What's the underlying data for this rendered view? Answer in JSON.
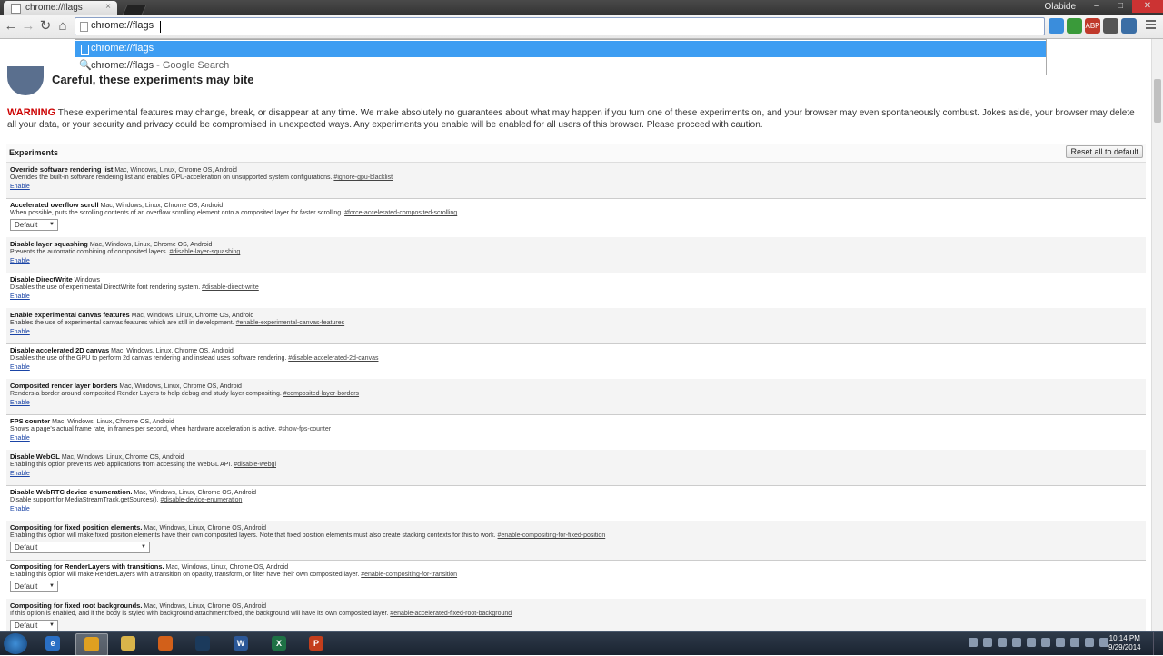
{
  "browser": {
    "tab_title": "chrome://flags",
    "tab_close": "×",
    "user_name": "Olabide",
    "window_controls": [
      "–",
      "□",
      "✕"
    ],
    "omnibox_text": "chrome://flags",
    "nav": {
      "back": "←",
      "forward": "→",
      "reload": "↻",
      "home": "⌂"
    },
    "extensions": [
      {
        "name": "skype-icon",
        "label": "",
        "color": "#3a8ddc"
      },
      {
        "name": "green-ext-icon",
        "label": "",
        "color": "#3a9a3a"
      },
      {
        "name": "adblock-icon",
        "label": "ABP",
        "color": "#c0392b"
      },
      {
        "name": "ghost-ext-icon",
        "label": "",
        "color": "#555555"
      },
      {
        "name": "puzzle-ext-icon",
        "label": "",
        "color": "#3b6ea5"
      }
    ]
  },
  "dropdown": {
    "suggestion_1": "chrome://flags",
    "suggestion_2_query": "chrome://flags",
    "suggestion_2_sub": " - Google Search"
  },
  "page": {
    "heading": "Careful, these experiments may bite",
    "warning_label": "WARNING",
    "warning_text": " These experimental features may change, break, or disappear at any time. We make absolutely no guarantees about what may happen if you turn one of these experiments on, and your browser may even spontaneously combust. Jokes aside, your browser may delete all your data, or your security and privacy could be compromised in unexpected ways. Any experiments you enable will be enabled for all users of this browser. Please proceed with caution.",
    "experiments_label": "Experiments",
    "reset_button": "Reset all to default"
  },
  "experiments": [
    {
      "name": "Override software rendering list",
      "platforms": " Mac, Windows, Linux, Chrome OS, Android",
      "desc": "Overrides the built-in software rendering list and enables GPU-acceleration on unsupported system configurations. ",
      "anchor": "#ignore-gpu-blacklist",
      "action": "Enable",
      "type": "link"
    },
    {
      "name": "Accelerated overflow scroll",
      "platforms": " Mac, Windows, Linux, Chrome OS, Android",
      "desc": "When possible, puts the scrolling contents of an overflow scrolling element onto a composited layer for faster scrolling. ",
      "anchor": "#force-accelerated-composited-scrolling",
      "action": "Default",
      "type": "select"
    },
    {
      "name": "Disable layer squashing",
      "platforms": " Mac, Windows, Linux, Chrome OS, Android",
      "desc": "Prevents the automatic combining of composited layers. ",
      "anchor": "#disable-layer-squashing",
      "action": "Enable",
      "type": "link"
    },
    {
      "name": "Disable DirectWrite",
      "platforms": " Windows",
      "desc": "Disables the use of experimental DirectWrite font rendering system. ",
      "anchor": "#disable-direct-write",
      "action": "Enable",
      "type": "link"
    },
    {
      "name": "Enable experimental canvas features",
      "platforms": " Mac, Windows, Linux, Chrome OS, Android",
      "desc": "Enables the use of experimental canvas features which are still in development. ",
      "anchor": "#enable-experimental-canvas-features",
      "action": "Enable",
      "type": "link"
    },
    {
      "name": "Disable accelerated 2D canvas",
      "platforms": " Mac, Windows, Linux, Chrome OS, Android",
      "desc": "Disables the use of the GPU to perform 2d canvas rendering and instead uses software rendering. ",
      "anchor": "#disable-accelerated-2d-canvas",
      "action": "Enable",
      "type": "link"
    },
    {
      "name": "Composited render layer borders",
      "platforms": " Mac, Windows, Linux, Chrome OS, Android",
      "desc": "Renders a border around composited Render Layers to help debug and study layer compositing. ",
      "anchor": "#composited-layer-borders",
      "action": "Enable",
      "type": "link"
    },
    {
      "name": "FPS counter",
      "platforms": " Mac, Windows, Linux, Chrome OS, Android",
      "desc": "Shows a page's actual frame rate, in frames per second, when hardware acceleration is active. ",
      "anchor": "#show-fps-counter",
      "action": "Enable",
      "type": "link"
    },
    {
      "name": "Disable WebGL",
      "platforms": " Mac, Windows, Linux, Chrome OS, Android",
      "desc": "Enabling this option prevents web applications from accessing the WebGL API. ",
      "anchor": "#disable-webgl",
      "action": "Enable",
      "type": "link"
    },
    {
      "name": "Disable WebRTC device enumeration.",
      "platforms": " Mac, Windows, Linux, Chrome OS, Android",
      "desc": "Disable support for MediaStreamTrack.getSources(). ",
      "anchor": "#disable-device-enumeration",
      "action": "Enable",
      "type": "link"
    },
    {
      "name": "Compositing for fixed position elements.",
      "platforms": " Mac, Windows, Linux, Chrome OS, Android",
      "desc": "Enabling this option will make fixed position elements have their own composited layers. Note that fixed position elements must also create stacking contexts for this to work. ",
      "anchor": "#enable-compositing-for-fixed-position",
      "action": "Default",
      "type": "select-wide"
    },
    {
      "name": "Compositing for RenderLayers with transitions.",
      "platforms": " Mac, Windows, Linux, Chrome OS, Android",
      "desc": "Enabling this option will make RenderLayers with a transition on opacity, transform, or filter have their own composited layer. ",
      "anchor": "#enable-compositing-for-transition",
      "action": "Default",
      "type": "select"
    },
    {
      "name": "Compositing for fixed root backgrounds.",
      "platforms": " Mac, Windows, Linux, Chrome OS, Android",
      "desc": "If this option is enabled, and if the body is styled with background-attachment:fixed, the background will have its own composited layer. ",
      "anchor": "#enable-accelerated-fixed-root-background",
      "action": "Default",
      "type": "select"
    }
  ],
  "taskbar": {
    "time": "10:14 PM",
    "date": "9/29/2014",
    "apps": [
      {
        "name": "ie-taskbar-icon",
        "label": "e",
        "color": "#2a6fc4",
        "active": false
      },
      {
        "name": "chrome-taskbar-icon",
        "label": "",
        "color": "#e0a020",
        "active": true
      },
      {
        "name": "explorer-taskbar-icon",
        "label": "",
        "color": "#d9b44a",
        "active": false
      },
      {
        "name": "firefox-taskbar-icon",
        "label": "",
        "color": "#d2601a",
        "active": false
      },
      {
        "name": "steam-taskbar-icon",
        "label": "",
        "color": "#1b3a5c",
        "active": false
      },
      {
        "name": "word-taskbar-icon",
        "label": "W",
        "color": "#2b5797",
        "active": false
      },
      {
        "name": "excel-taskbar-icon",
        "label": "X",
        "color": "#1e7145",
        "active": false
      },
      {
        "name": "powerpoint-taskbar-icon",
        "label": "P",
        "color": "#c43e1c",
        "active": false
      }
    ]
  }
}
